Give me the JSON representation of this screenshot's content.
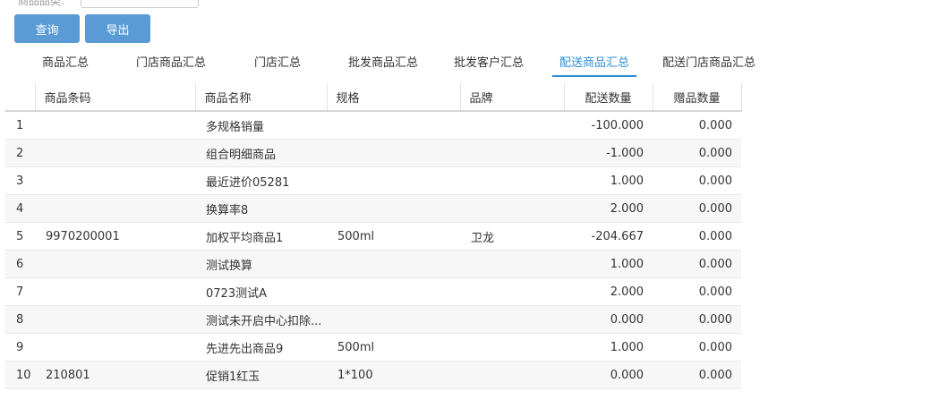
{
  "filter": {
    "label": "商品品类:"
  },
  "toolbar": {
    "query_label": "查询",
    "export_label": "导出"
  },
  "tabs": [
    {
      "label": "商品汇总"
    },
    {
      "label": "门店商品汇总"
    },
    {
      "label": "门店汇总"
    },
    {
      "label": "批发商品汇总"
    },
    {
      "label": "批发客户汇总"
    },
    {
      "label": "配送商品汇总",
      "active": true
    },
    {
      "label": "配送门店商品汇总"
    }
  ],
  "table": {
    "headers": {
      "index": "",
      "barcode": "商品条码",
      "name": "商品名称",
      "spec": "规格",
      "brand": "品牌",
      "qty": "配送数量",
      "gift": "赠品数量"
    },
    "rows": [
      {
        "index": "1",
        "barcode": "",
        "name": "多规格销量",
        "spec": "",
        "brand": "",
        "qty": "-100.000",
        "gift": "0.000"
      },
      {
        "index": "2",
        "barcode": "",
        "name": "组合明细商品",
        "spec": "",
        "brand": "",
        "qty": "-1.000",
        "gift": "0.000"
      },
      {
        "index": "3",
        "barcode": "",
        "name": "最近进价05281",
        "spec": "",
        "brand": "",
        "qty": "1.000",
        "gift": "0.000"
      },
      {
        "index": "4",
        "barcode": "",
        "name": "换算率8",
        "spec": "",
        "brand": "",
        "qty": "2.000",
        "gift": "0.000"
      },
      {
        "index": "5",
        "barcode": "9970200001",
        "name": "加权平均商品1",
        "spec": "500ml",
        "brand": "卫龙",
        "qty": "-204.667",
        "gift": "0.000"
      },
      {
        "index": "6",
        "barcode": "",
        "name": "测试换算",
        "spec": "",
        "brand": "",
        "qty": "1.000",
        "gift": "0.000"
      },
      {
        "index": "7",
        "barcode": "",
        "name": "0723测试A",
        "spec": "",
        "brand": "",
        "qty": "2.000",
        "gift": "0.000"
      },
      {
        "index": "8",
        "barcode": "",
        "name": "测试未开启中心扣除...",
        "spec": "",
        "brand": "",
        "qty": "0.000",
        "gift": "0.000"
      },
      {
        "index": "9",
        "barcode": "",
        "name": "先进先出商品9",
        "spec": "500ml",
        "brand": "",
        "qty": "1.000",
        "gift": "0.000"
      },
      {
        "index": "10",
        "barcode": "210801",
        "name": "促销1红玉",
        "spec": "1*100",
        "brand": "",
        "qty": "0.000",
        "gift": "0.000"
      }
    ]
  }
}
